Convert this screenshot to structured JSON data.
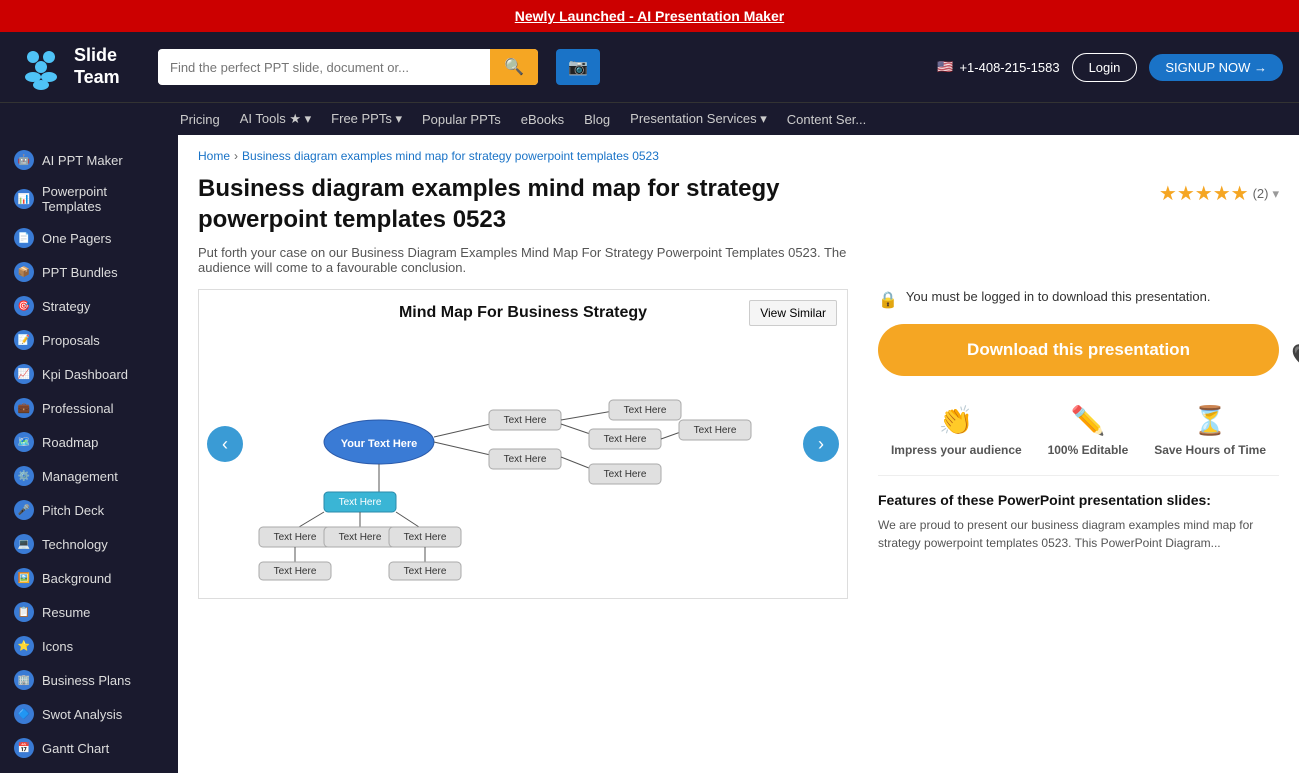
{
  "banner": {
    "text": "Newly Launched - AI Presentation Maker",
    "link": "Newly Launched - AI Presentation Maker"
  },
  "header": {
    "logo_line1": "Slide",
    "logo_line2": "Team",
    "search_placeholder": "Find the perfect PPT slide, document or...",
    "phone": "+1-408-215-1583",
    "login_label": "Login",
    "signup_label": "SIGNUP NOW →"
  },
  "nav": {
    "items": [
      {
        "label": "Pricing"
      },
      {
        "label": "AI Tools ★ ▾"
      },
      {
        "label": "Free PPTs ▾"
      },
      {
        "label": "Popular PPTs"
      },
      {
        "label": "eBooks"
      },
      {
        "label": "Blog"
      },
      {
        "label": "Presentation Services ▾"
      },
      {
        "label": "Content Ser..."
      }
    ]
  },
  "sidebar": {
    "items": [
      {
        "label": "AI PPT Maker"
      },
      {
        "label": "Powerpoint Templates"
      },
      {
        "label": "One Pagers"
      },
      {
        "label": "PPT Bundles"
      },
      {
        "label": "Strategy"
      },
      {
        "label": "Proposals"
      },
      {
        "label": "Kpi Dashboard"
      },
      {
        "label": "Professional"
      },
      {
        "label": "Roadmap"
      },
      {
        "label": "Management"
      },
      {
        "label": "Pitch Deck"
      },
      {
        "label": "Technology"
      },
      {
        "label": "Background"
      },
      {
        "label": "Resume"
      },
      {
        "label": "Icons"
      },
      {
        "label": "Business Plans"
      },
      {
        "label": "Swot Analysis"
      },
      {
        "label": "Gantt Chart"
      }
    ]
  },
  "breadcrumb": {
    "home": "Home",
    "separator": "›",
    "current": "Business diagram examples mind map for strategy powerpoint templates 0523"
  },
  "product": {
    "title": "Business diagram examples mind map for strategy powerpoint templates 0523",
    "description": "Put forth your case on our Business Diagram Examples Mind Map For Strategy Powerpoint Templates 0523. The audience will come to a favourable conclusion.",
    "stars": "★★★★★",
    "review_count": "(2)",
    "slide_title": "Mind Map For Business Strategy",
    "view_similar": "View Similar",
    "login_notice": "You must be logged in to download this presentation.",
    "download_btn": "Download this presentation",
    "feature1_label": "Impress your audience",
    "feature2_label": "100% Editable",
    "feature3_label": "Save Hours of Time",
    "features_heading": "Features of these PowerPoint presentation slides:",
    "features_desc": "We are proud to present our business diagram examples mind map for strategy powerpoint templates 0523. This PowerPoint Diagram..."
  }
}
